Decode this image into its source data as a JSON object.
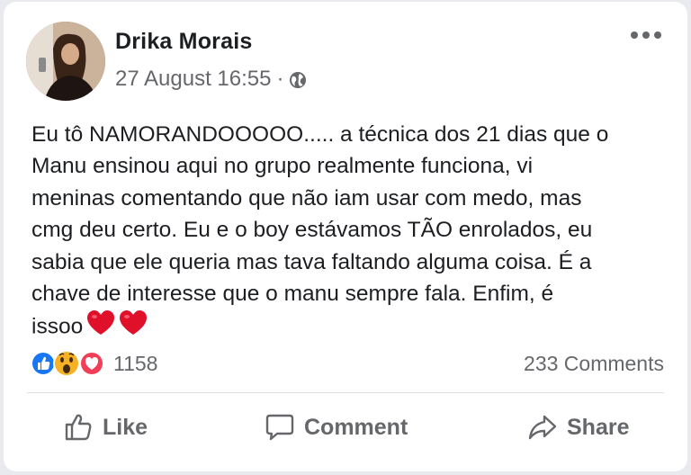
{
  "post": {
    "author": "Drika Morais",
    "timestamp": "27 August 16:55",
    "separator": "·",
    "privacy_icon": "globe-icon",
    "more_icon": "more-options-icon",
    "text_lines": [
      "Eu tô NAMORANDOOOOO..... a técnica dos 21 dias que o",
      "Manu ensinou aqui no grupo realmente funciona, vi",
      "meninas comentando que não iam usar com medo, mas",
      "cmg deu certo. Eu e o boy estávamos TÃO enrolados, eu",
      "sabia que ele queria mas tava faltando alguma coisa. É a",
      "chave de interesse que o manu sempre fala. Enfim, é",
      "issoo"
    ],
    "reactions": {
      "count": "1158",
      "types": [
        "like",
        "wow",
        "love"
      ]
    },
    "comments_label": "233 Comments"
  },
  "actions": {
    "like_label": "Like",
    "comment_label": "Comment",
    "share_label": "Share"
  },
  "colors": {
    "like_blue": "#1877f2",
    "love_red": "#f33e58",
    "wow_yellow": "#f7b125",
    "secondary_text": "#65676b",
    "primary_text": "#1c1e21"
  }
}
